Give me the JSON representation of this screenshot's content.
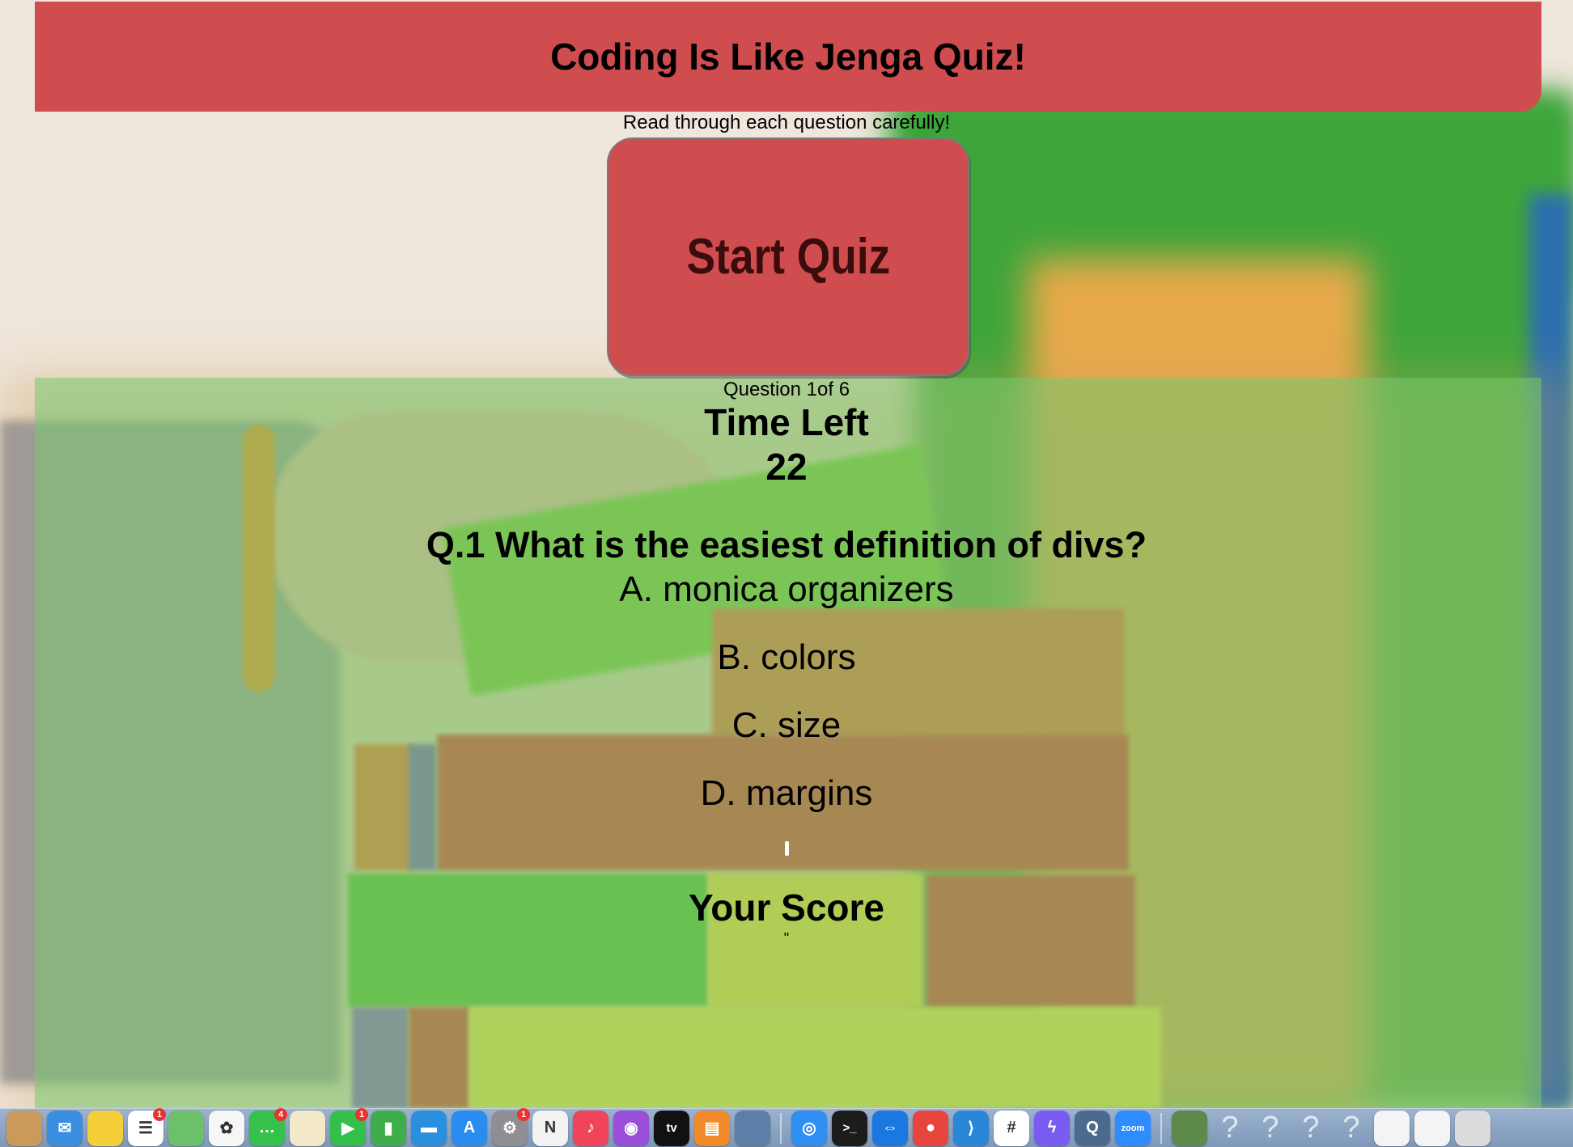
{
  "header": {
    "title": "Coding Is Like Jenga Quiz!",
    "subtitle": "Read through each question carefully!"
  },
  "start_button": {
    "label": "Start Quiz"
  },
  "quiz": {
    "counter": "Question 1of 6",
    "time_label": "Time Left",
    "time_value": "22",
    "question": "Q.1 What is the easiest definition of divs?",
    "answers": [
      "A. monica organizers",
      "B. colors",
      "C. size",
      "D. margins"
    ],
    "score_label": "Your Score",
    "score_value": "\""
  },
  "dock": {
    "apps": [
      {
        "name": "finder-icon",
        "glyph": "",
        "color": "#c99a5a"
      },
      {
        "name": "mail-icon",
        "glyph": "✉",
        "color": "#3b8de0"
      },
      {
        "name": "notes-icon",
        "glyph": "",
        "color": "#f5cf3a"
      },
      {
        "name": "reminders-icon",
        "glyph": "☰",
        "color": "#ffffff",
        "badge": "1"
      },
      {
        "name": "maps-icon",
        "glyph": "",
        "color": "#6cc06a"
      },
      {
        "name": "photos-icon",
        "glyph": "✿",
        "color": "#f6f6f6"
      },
      {
        "name": "messages-icon",
        "glyph": "…",
        "color": "#36c24a",
        "badge": "4"
      },
      {
        "name": "textedit-icon",
        "glyph": "",
        "color": "#f3e9c8"
      },
      {
        "name": "facetime-icon",
        "glyph": "▶",
        "color": "#32c04a",
        "badge": "1"
      },
      {
        "name": "numbers-icon",
        "glyph": "▮",
        "color": "#3fae4a"
      },
      {
        "name": "keynote-icon",
        "glyph": "▬",
        "color": "#2b8fe0"
      },
      {
        "name": "app-store-icon",
        "glyph": "A",
        "color": "#2a8cf0"
      },
      {
        "name": "system-preferences-icon",
        "glyph": "⚙",
        "color": "#8e8e93",
        "badge": "1"
      },
      {
        "name": "news-icon",
        "glyph": "N",
        "color": "#f2f2f2"
      },
      {
        "name": "music-icon",
        "glyph": "♪",
        "color": "#f0445a"
      },
      {
        "name": "podcasts-icon",
        "glyph": "◉",
        "color": "#9a4fd8"
      },
      {
        "name": "apple-tv-icon",
        "glyph": "tv",
        "color": "#111111"
      },
      {
        "name": "books-icon",
        "glyph": "▤",
        "color": "#f08a2a"
      },
      {
        "name": "preview-icon",
        "glyph": "",
        "color": "#5c7fa8"
      }
    ],
    "apps2": [
      {
        "name": "safari-icon",
        "glyph": "◎",
        "color": "#2f8ef2"
      },
      {
        "name": "terminal-icon",
        "glyph": ">_",
        "color": "#1c1c1c"
      },
      {
        "name": "teamviewer-icon",
        "glyph": "⇔",
        "color": "#1a78e0"
      },
      {
        "name": "chrome-icon",
        "glyph": "●",
        "color": "#e8453c"
      },
      {
        "name": "vscode-icon",
        "glyph": "⟩",
        "color": "#2a86d6"
      },
      {
        "name": "slack-icon",
        "glyph": "#",
        "color": "#ffffff"
      },
      {
        "name": "messenger-icon",
        "glyph": "ϟ",
        "color": "#7b5cf2"
      },
      {
        "name": "quicktime-icon",
        "glyph": "Q",
        "color": "#4a6a8e"
      },
      {
        "name": "zoom-icon",
        "glyph": "zoom",
        "color": "#2d8cff"
      }
    ],
    "apps3": [
      {
        "name": "image-thumbnail-icon",
        "glyph": "",
        "color": "#5d8a4a"
      }
    ],
    "unknown_glyph": "?",
    "docs": [
      {
        "name": "document-thumbnail-icon",
        "glyph": "",
        "color": "#f4f4f4"
      },
      {
        "name": "document-thumbnail-icon",
        "glyph": "",
        "color": "#f4f4f4"
      },
      {
        "name": "screenshot-thumbnail-icon",
        "glyph": "",
        "color": "#dcdcdc"
      }
    ]
  }
}
